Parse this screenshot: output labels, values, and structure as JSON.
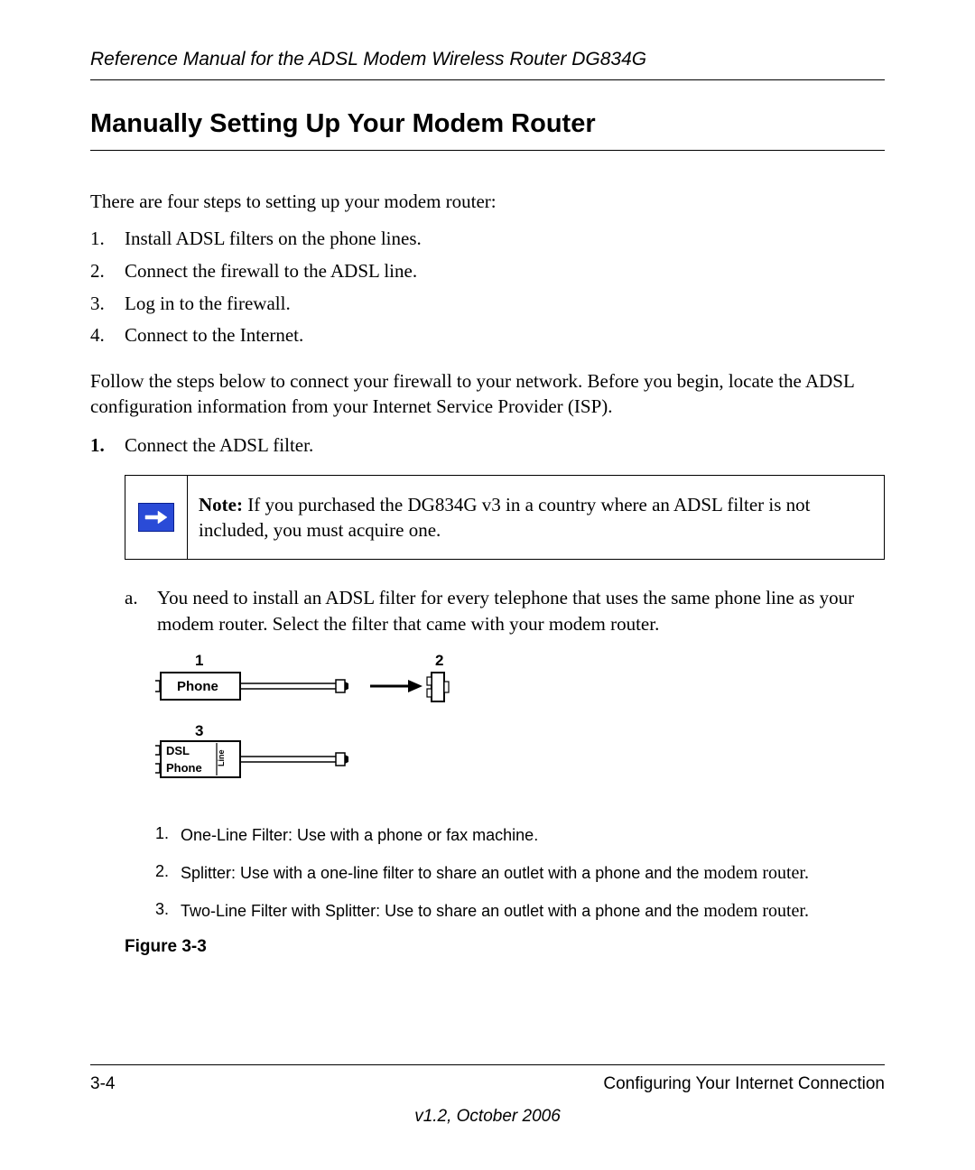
{
  "header": {
    "manual_title": "Reference Manual for the ADSL Modem Wireless Router DG834G"
  },
  "section": {
    "title": "Manually Setting Up Your Modem Router"
  },
  "intro": "There are four steps to setting up your modem router:",
  "steps_overview": [
    "Install ADSL filters on the phone lines.",
    "Connect the firewall to the ADSL line.",
    "Log in to the firewall.",
    "Connect to the Internet."
  ],
  "followup": "Follow the steps below to connect your firewall to your network. Before you begin, locate the ADSL configuration information from your Internet Service Provider (ISP).",
  "main_step": {
    "number": "1.",
    "text": "Connect the ADSL filter."
  },
  "note": {
    "label": "Note:",
    "text": " If you purchased the DG834G v3 in a country where an ADSL filter is not included, you must acquire one."
  },
  "substep": {
    "letter": "a.",
    "text": "You need to install an ADSL filter for every telephone that uses the same phone line as your modem router. Select the filter that came with your modem router."
  },
  "diagram": {
    "parts": {
      "1": {
        "label": "Phone"
      },
      "2": {
        "label": ""
      },
      "3": {
        "labels": [
          "DSL",
          "Phone"
        ],
        "side_label": "Line"
      }
    }
  },
  "figure_items": [
    {
      "num": "1.",
      "text": "One-Line Filter: Use with a phone or fax machine.",
      "tail": ""
    },
    {
      "num": "2.",
      "text": "Splitter: Use with a one-line filter to share an outlet with a phone and the ",
      "tail": "modem router."
    },
    {
      "num": "3.",
      "text": "Two-Line Filter with Splitter: Use to share an outlet with a phone and the ",
      "tail": "modem router."
    }
  ],
  "figure_label": "Figure 3-3",
  "footer": {
    "page": "3-4",
    "chapter": "Configuring Your Internet Connection",
    "version": "v1.2, October 2006"
  }
}
